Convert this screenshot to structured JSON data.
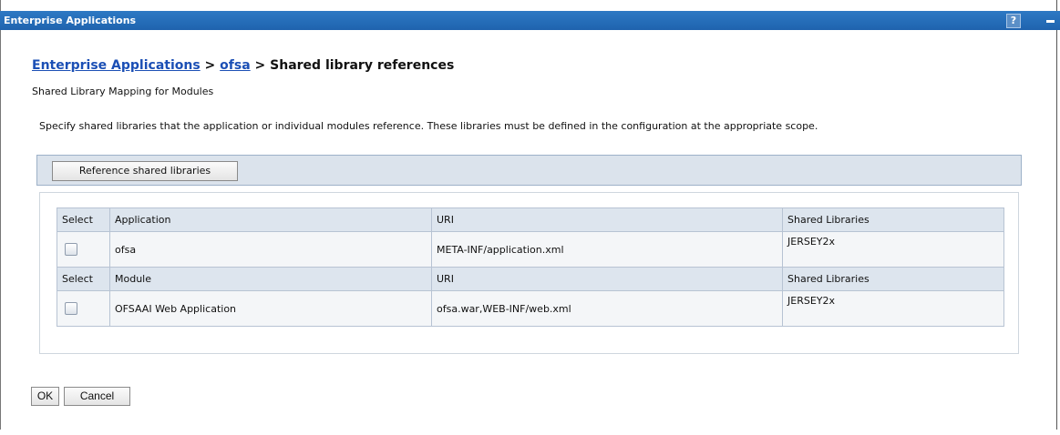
{
  "window": {
    "title": "Enterprise Applications",
    "help_glyph": "?"
  },
  "breadcrumb": {
    "link1": "Enterprise Applications",
    "sep1": " > ",
    "link2": "ofsa",
    "sep2": " > ",
    "current": "Shared library references"
  },
  "subtitle": "Shared Library Mapping for Modules",
  "description": "Specify shared libraries that the application or individual modules reference. These libraries must be defined in the configuration at the appropriate scope.",
  "toolbar": {
    "reference_button": "Reference shared libraries"
  },
  "table": {
    "app_header": {
      "select": "Select",
      "name": "Application",
      "uri": "URI",
      "libs": "Shared Libraries"
    },
    "app_row": {
      "name": "ofsa",
      "uri": "META-INF/application.xml",
      "libs": "JERSEY2x"
    },
    "module_header": {
      "select": "Select",
      "name": "Module",
      "uri": "URI",
      "libs": "Shared Libraries"
    },
    "module_row": {
      "name": "OFSAAI Web Application",
      "uri": "ofsa.war,WEB-INF/web.xml",
      "libs": "JERSEY2x"
    }
  },
  "actions": {
    "ok": "OK",
    "cancel": "Cancel"
  }
}
